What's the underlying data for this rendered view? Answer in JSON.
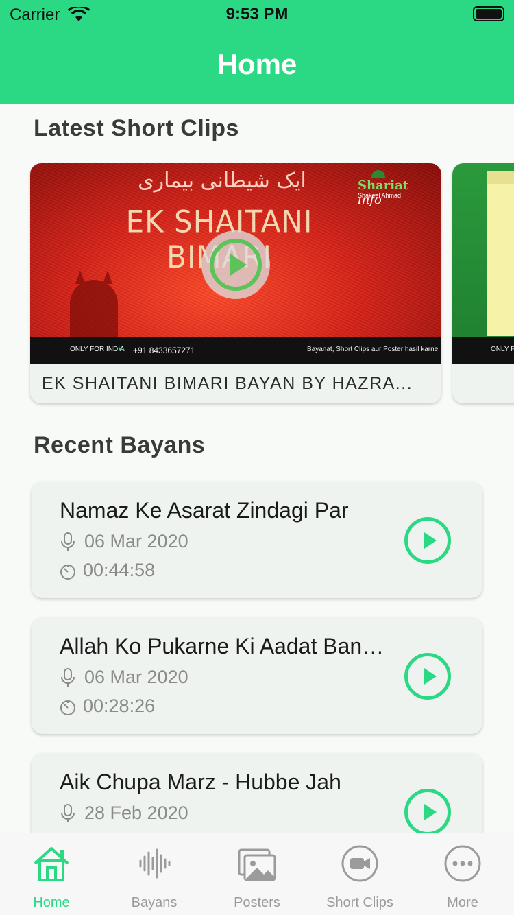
{
  "status_bar": {
    "carrier": "Carrier",
    "time": "9:53 PM"
  },
  "header": {
    "title": "Home"
  },
  "sections": {
    "short_clips": "Latest Short Clips",
    "recent_bayans": "Recent Bayans"
  },
  "clips": [
    {
      "caption": "EK SHAITANI BIMARI  BAYAN BY HAZRA...",
      "urdu_title": "ایک شیطانی بیماری",
      "overlay_title": "EK SHAITANI BIMARI",
      "brand": "Shariat",
      "brand_suffix": "info",
      "brand_sub": "Shakeel Ahmad",
      "strip_left": "ONLY FOR INDIA",
      "strip_phone": "+91 8433657271",
      "strip_right": "Bayanat, Short Clips aur Poster hasil karne"
    },
    {
      "caption": "",
      "strip_left": "ONLY FO"
    }
  ],
  "bayans": [
    {
      "title": "Namaz Ke Asarat Zindagi Par",
      "date": "06 Mar 2020",
      "duration": "00:44:58"
    },
    {
      "title": "Allah Ko Pukarne Ki Aadat Banane Ki Zaroorat",
      "date": "06 Mar 2020",
      "duration": "00:28:26"
    },
    {
      "title": "Aik Chupa Marz - Hubbe Jah",
      "date": "28 Feb 2020",
      "duration": ""
    }
  ],
  "tabs": [
    {
      "label": "Home",
      "icon": "home-icon",
      "active": true
    },
    {
      "label": "Bayans",
      "icon": "audio-wave-icon",
      "active": false
    },
    {
      "label": "Posters",
      "icon": "images-icon",
      "active": false
    },
    {
      "label": "Short Clips",
      "icon": "video-camera-icon",
      "active": false
    },
    {
      "label": "More",
      "icon": "more-icon",
      "active": false
    }
  ],
  "colors": {
    "accent": "#2bd984",
    "tab_inactive": "#9b9b9b"
  }
}
